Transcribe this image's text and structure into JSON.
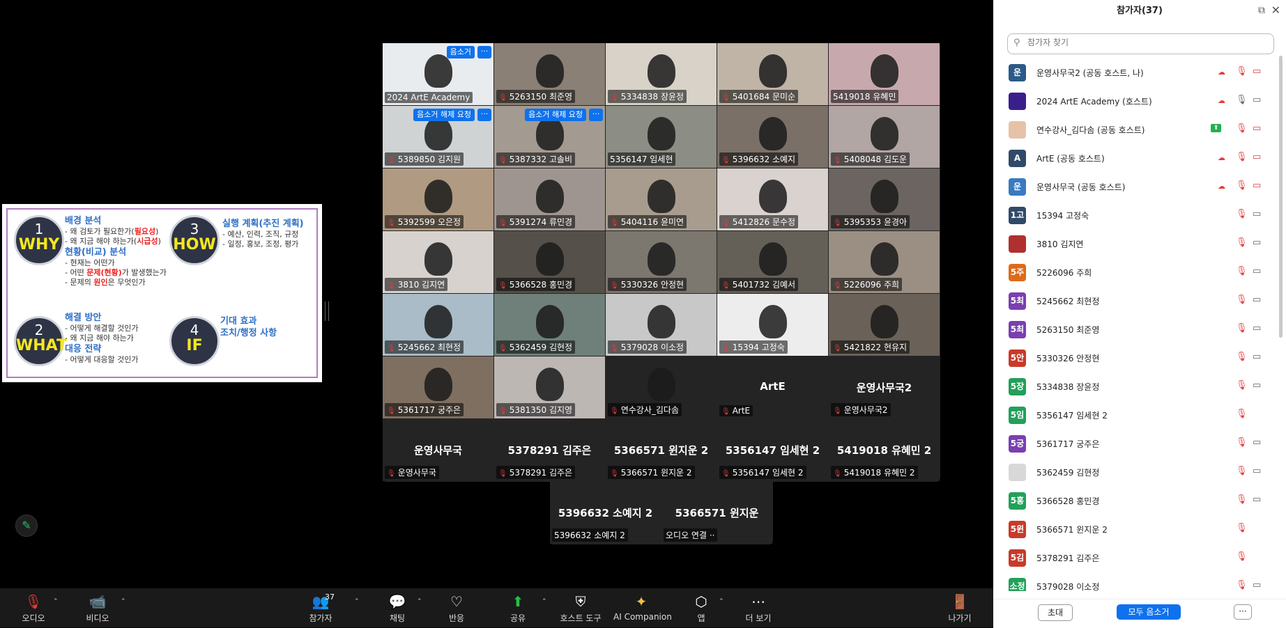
{
  "slide": {
    "b1": {
      "num": "1",
      "word": "WHY",
      "h1": "배경 분석",
      "l1a": "- 왜 검토가 필요한가(",
      "l1a_r": "필요성",
      "l1a_e": ")",
      "l1b": "- 왜 지금 해야 하는가(",
      "l1b_r": "시급성",
      "l1b_e": ")",
      "h2": "현황(비교) 분석",
      "l2a": "- 현재는 어떤가",
      "l2b": "- 어떤 ",
      "l2b_r": "문제(현황)",
      "l2b_e": "가 발생했는가",
      "l2c": "- 문제의 ",
      "l2c_r": "원인",
      "l2c_e": "은 무엇인가"
    },
    "b2": {
      "num": "2",
      "word": "WHAT",
      "h1": "해결 방안",
      "l1a": "- 어떻게 해결할 것인가",
      "l1b": "- 왜 지금 해야 하는가",
      "h2": "대응 전략",
      "l2a": "- 어떻게 대응할 것인가"
    },
    "b3": {
      "num": "3",
      "word": "HOW",
      "h1": "실행 계획(추진 계획)",
      "l1a": "- 예산, 인력, 조직, 규정",
      "l1b": "- 일정, 홍보, 조정, 평가"
    },
    "b4": {
      "num": "4",
      "word": "IF",
      "h1": "기대 효과",
      "h2": "조치/행정 사항"
    }
  },
  "gallery": {
    "tiles": [
      {
        "name": "2024 ArtE Academy",
        "muted": false,
        "btn": "음소거"
      },
      {
        "name": "5263150 최준영",
        "muted": true
      },
      {
        "name": "5334838 장윤정",
        "muted": true
      },
      {
        "name": "5401684 문미순",
        "muted": true
      },
      {
        "name": "5419018 유혜민",
        "muted": false
      },
      {
        "name": "5389850 김지원",
        "muted": true,
        "btn": "음소거 해제 요청"
      },
      {
        "name": "5387332 고솔비",
        "muted": true,
        "btn": "음소거 해제 요청"
      },
      {
        "name": "5356147 임세현",
        "muted": false
      },
      {
        "name": "5396632 소예지",
        "muted": true
      },
      {
        "name": "5408048 김도운",
        "muted": true
      },
      {
        "name": "5392599 오은정",
        "muted": true
      },
      {
        "name": "5391274 류민경",
        "muted": true
      },
      {
        "name": "5404116 윤미연",
        "muted": true
      },
      {
        "name": "5412826 문수정",
        "muted": true
      },
      {
        "name": "5395353 윤경아",
        "muted": true
      },
      {
        "name": "3810 김지연",
        "muted": true
      },
      {
        "name": "5366528 홍민경",
        "muted": true
      },
      {
        "name": "5330326 안정현",
        "muted": true
      },
      {
        "name": "5401732 김예서",
        "muted": true
      },
      {
        "name": "5226096 주희",
        "muted": true
      },
      {
        "name": "5245662 최현정",
        "muted": true
      },
      {
        "name": "5362459 김현정",
        "muted": true
      },
      {
        "name": "5379028 이소정",
        "muted": true
      },
      {
        "name": "15394 고정숙",
        "muted": true
      },
      {
        "name": "5421822 현유지",
        "muted": true
      },
      {
        "name": "5361717 궁주은",
        "muted": true
      },
      {
        "name": "5381350 김지영",
        "muted": true
      },
      {
        "name": "연수강사_김다솜",
        "muted": true
      },
      {
        "name": "ArtE",
        "muted": true,
        "big": "ArtE"
      },
      {
        "name": "운영사무국2",
        "muted": true,
        "big": "운영사무국2"
      },
      {
        "name": "운영사무국",
        "muted": true,
        "big": "운영사무국"
      },
      {
        "name": "5378291 김주은",
        "muted": true,
        "big": "5378291 김주은"
      },
      {
        "name": "5366571 윈지운 2",
        "muted": true,
        "big": "5366571 윈지운 2"
      },
      {
        "name": "5356147 임세현 2",
        "muted": true,
        "big": "5356147 임세현 2"
      },
      {
        "name": "5419018 유혜민 2",
        "muted": true,
        "big": "5419018 유혜민 2"
      },
      {
        "name": "5396632 소예지 2",
        "muted": false,
        "big": "5396632 소예지 2"
      },
      {
        "name": "오디오 연결 ··",
        "muted": false,
        "big": "5366571 윈지운"
      }
    ]
  },
  "toolbar": {
    "audio": "오디오",
    "video": "비디오",
    "participants": "참가자",
    "participants_count": "37",
    "chat": "채팅",
    "react": "반응",
    "share": "공유",
    "host_tools": "호스트 도구",
    "ai": "AI Companion",
    "apps": "앱",
    "more": "더 보기",
    "leave": "나가기"
  },
  "panel": {
    "title": "참가자(37)",
    "search_placeholder": "참가자 찾기",
    "invite": "초대",
    "mute_all": "모두 음소거",
    "more": "···",
    "participants": [
      {
        "initial": "운",
        "color": "#2a5a88",
        "name": "운영사무국2 (공동 호스트, 나)",
        "cloud": true,
        "mic": "off",
        "cam": "off"
      },
      {
        "initial": "",
        "color": "#3a1f8c",
        "name": "2024 ArtE Academy (호스트)",
        "cloud": true,
        "mic": "on",
        "cam": "on"
      },
      {
        "initial": "",
        "color": "#e6c2a8",
        "name": "연수강사_김다솜 (공동 호스트)",
        "share": true,
        "mic": "off",
        "cam": "off"
      },
      {
        "initial": "A",
        "color": "#324a6a",
        "name": "ArtE (공동 호스트)",
        "cloud": true,
        "mic": "off",
        "cam": "off"
      },
      {
        "initial": "운",
        "color": "#3a7ac0",
        "name": "운영사무국 (공동 호스트)",
        "cloud": true,
        "mic": "off",
        "cam": "off"
      },
      {
        "initial": "1고",
        "color": "#324a6a",
        "name": "15394 고정숙",
        "mic": "off",
        "cam": "on"
      },
      {
        "initial": "",
        "color": "#b03030",
        "name": "3810 김지연",
        "mic": "off",
        "cam": "on"
      },
      {
        "initial": "5주",
        "color": "#e06a1a",
        "name": "5226096 주희",
        "mic": "off",
        "cam": "on"
      },
      {
        "initial": "5최",
        "color": "#7a3fb0",
        "name": "5245662 최현정",
        "mic": "off",
        "cam": "on"
      },
      {
        "initial": "5최",
        "color": "#7a3fb0",
        "name": "5263150 최준영",
        "mic": "off",
        "cam": "on"
      },
      {
        "initial": "5안",
        "color": "#c83a2a",
        "name": "5330326 안정현",
        "mic": "off",
        "cam": "on"
      },
      {
        "initial": "5장",
        "color": "#23a05a",
        "name": "5334838 장윤정",
        "mic": "off",
        "cam": "on"
      },
      {
        "initial": "5임",
        "color": "#23a05a",
        "name": "5356147 임세현 2",
        "mic": "off"
      },
      {
        "initial": "5궁",
        "color": "#7a3fb0",
        "name": "5361717 궁주은",
        "mic": "off",
        "cam": "on"
      },
      {
        "initial": "",
        "color": "#d8d8d8",
        "name": "5362459 김현정",
        "mic": "off",
        "cam": "on"
      },
      {
        "initial": "5홍",
        "color": "#23a05a",
        "name": "5366528 홍민경",
        "mic": "off",
        "cam": "on"
      },
      {
        "initial": "5윈",
        "color": "#c83a2a",
        "name": "5366571 윈지운 2",
        "mic": "off"
      },
      {
        "initial": "5김",
        "color": "#c83a2a",
        "name": "5378291 김주은",
        "mic": "off"
      },
      {
        "initial": "소정",
        "color": "#23a05a",
        "name": "5379028 이소정",
        "mic": "off",
        "cam": "on"
      }
    ]
  }
}
